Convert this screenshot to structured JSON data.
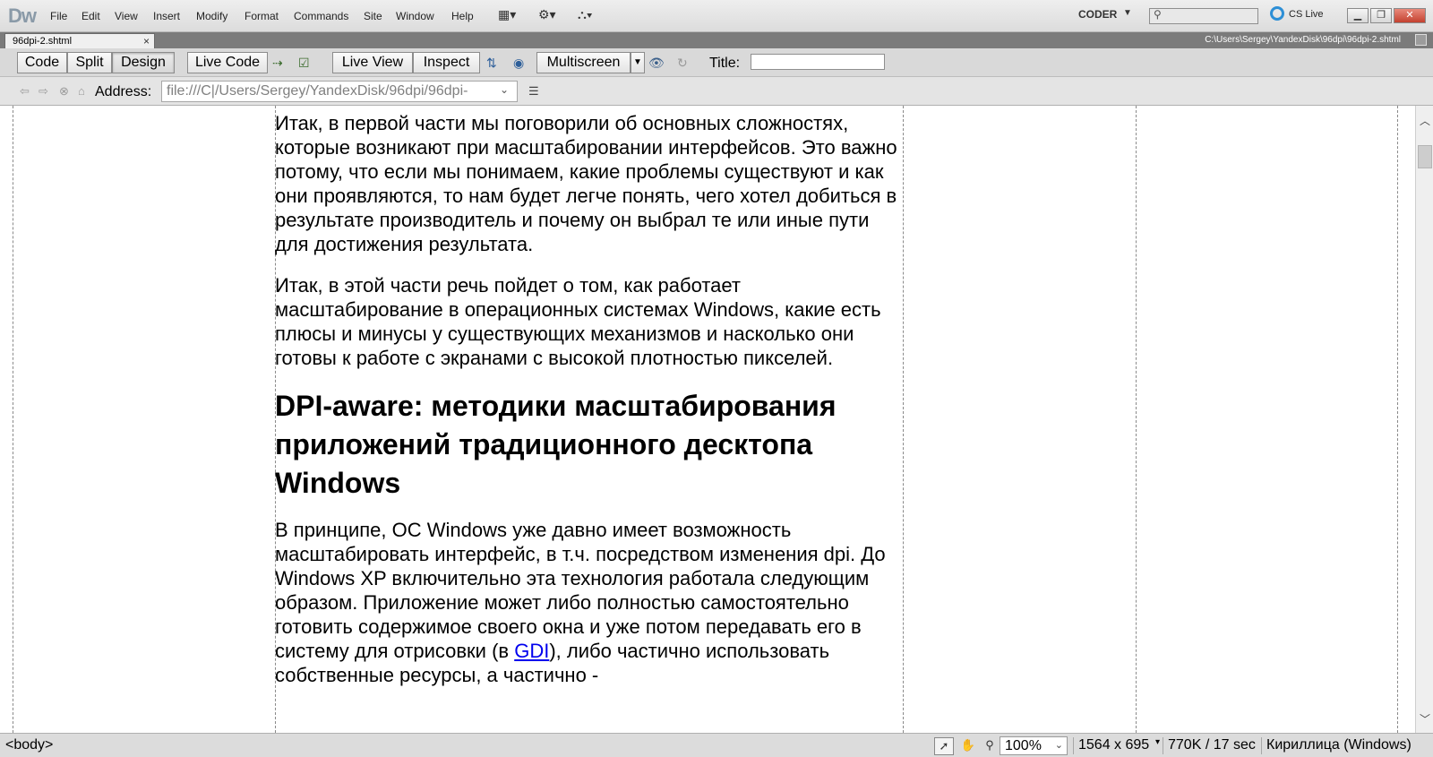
{
  "app": {
    "logo": "Dw",
    "menu": [
      "File",
      "Edit",
      "View",
      "Insert",
      "Modify",
      "Format",
      "Commands",
      "Site",
      "Window",
      "Help"
    ],
    "workspace": "CODER",
    "cs_live": "CS Live",
    "search_placeholder": ""
  },
  "document_tab": {
    "name": "96dpi-2.shtml",
    "close": "×",
    "path": "C:\\Users\\Sergey\\YandexDisk\\96dpi\\96dpi-2.shtml"
  },
  "doc_toolbar": {
    "code": "Code",
    "split": "Split",
    "design": "Design",
    "live_code": "Live Code",
    "live_view": "Live View",
    "inspect": "Inspect",
    "multiscreen": "Multiscreen",
    "title_label": "Title:",
    "title_value": ""
  },
  "address_bar": {
    "label": "Address:",
    "value": "file:///C|/Users/Sergey/YandexDisk/96dpi/96dpi-"
  },
  "content": {
    "p1": "Итак, в первой части мы поговорили об основных сложностях, которые возникают при масштабировании интерфейсов. Это важно потому, что если мы понимаем, какие проблемы существуют и как они проявляются, то нам будет легче понять, чего хотел добиться в результате производитель и почему он выбрал те или иные пути для достижения результата.",
    "p2": "Итак, в этой части речь пойдет о том, как работает масштабирование в операционных системах Windows, какие есть плюсы и минусы у существующих механизмов и насколько они готовы к работе с экранами с высокой плотностью пикселей.",
    "h1": "DPI-aware: методики масштабирования приложений традиционного десктопа Windows",
    "p3_before": "В принципе, ОС Windows уже давно имеет возможность масштабировать интерфейс, в т.ч. посредством изменения dpi. До Windows XP включительно эта технология работала следующим образом. Приложение может либо полностью самостоятельно готовить содержимое своего окна и уже потом передавать его в систему для отрисовки (в ",
    "p3_link": "GDI",
    "p3_after": "), либо частично использовать собственные ресурсы, а частично -"
  },
  "status_bar": {
    "tag": "<body>",
    "zoom": "100%",
    "dimensions": "1564 x 695",
    "size_time": "770K / 17 sec",
    "encoding": "Кириллица (Windows)"
  },
  "colors": {
    "link": "#0000ee",
    "cs_live_icon": "#2d8fd6",
    "close_button": "#c4412f"
  }
}
